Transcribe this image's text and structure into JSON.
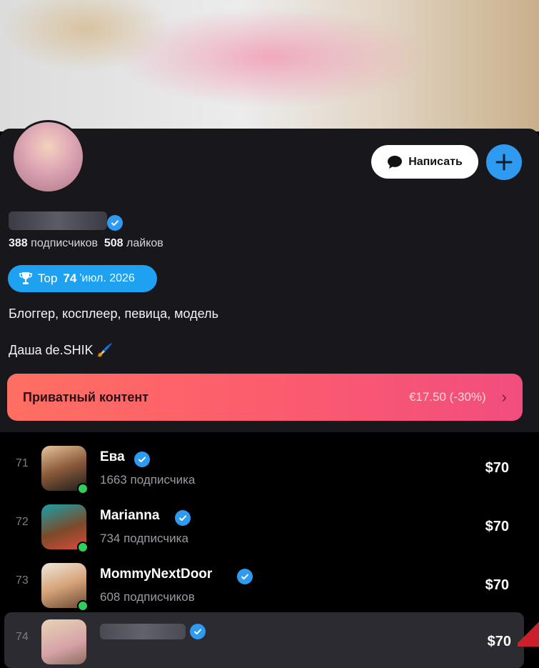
{
  "profile": {
    "followers_count": "388",
    "followers_label": "подписчиков",
    "likes_count": "508",
    "likes_label": "лайков",
    "top_badge": {
      "label": "Top",
      "rank": "74",
      "date": "'июл. 2026"
    },
    "bio_line1": "Блоггер, косплеер, певица, модель",
    "bio_line2": "Даша de.SHIK",
    "bio_emoji": "🖌️"
  },
  "actions": {
    "message_label": "Написать",
    "add_icon": "plus-icon",
    "message_icon": "speech-bubble-icon"
  },
  "private_content": {
    "title": "Приватный контент",
    "price": "€17.50 (-30%)",
    "chevron": "›"
  },
  "rankings": [
    {
      "rank": "71",
      "name": "Ева",
      "subscribers": "1663 подписчика",
      "price": "$70",
      "online": true
    },
    {
      "rank": "72",
      "name": "Marianna",
      "subscribers": "734 подписчика",
      "price": "$70",
      "online": true
    },
    {
      "rank": "73",
      "name": "MommyNextDoor",
      "subscribers": "608 подписчиков",
      "price": "$70",
      "online": true
    },
    {
      "rank": "74",
      "name": "",
      "subscribers": "",
      "price": "$70",
      "online": false
    }
  ],
  "colors": {
    "accent": "#2e9bf0",
    "private_gradient_start": "#ff6f61",
    "private_gradient_end": "#f14d7f",
    "online": "#2fcf5a"
  }
}
